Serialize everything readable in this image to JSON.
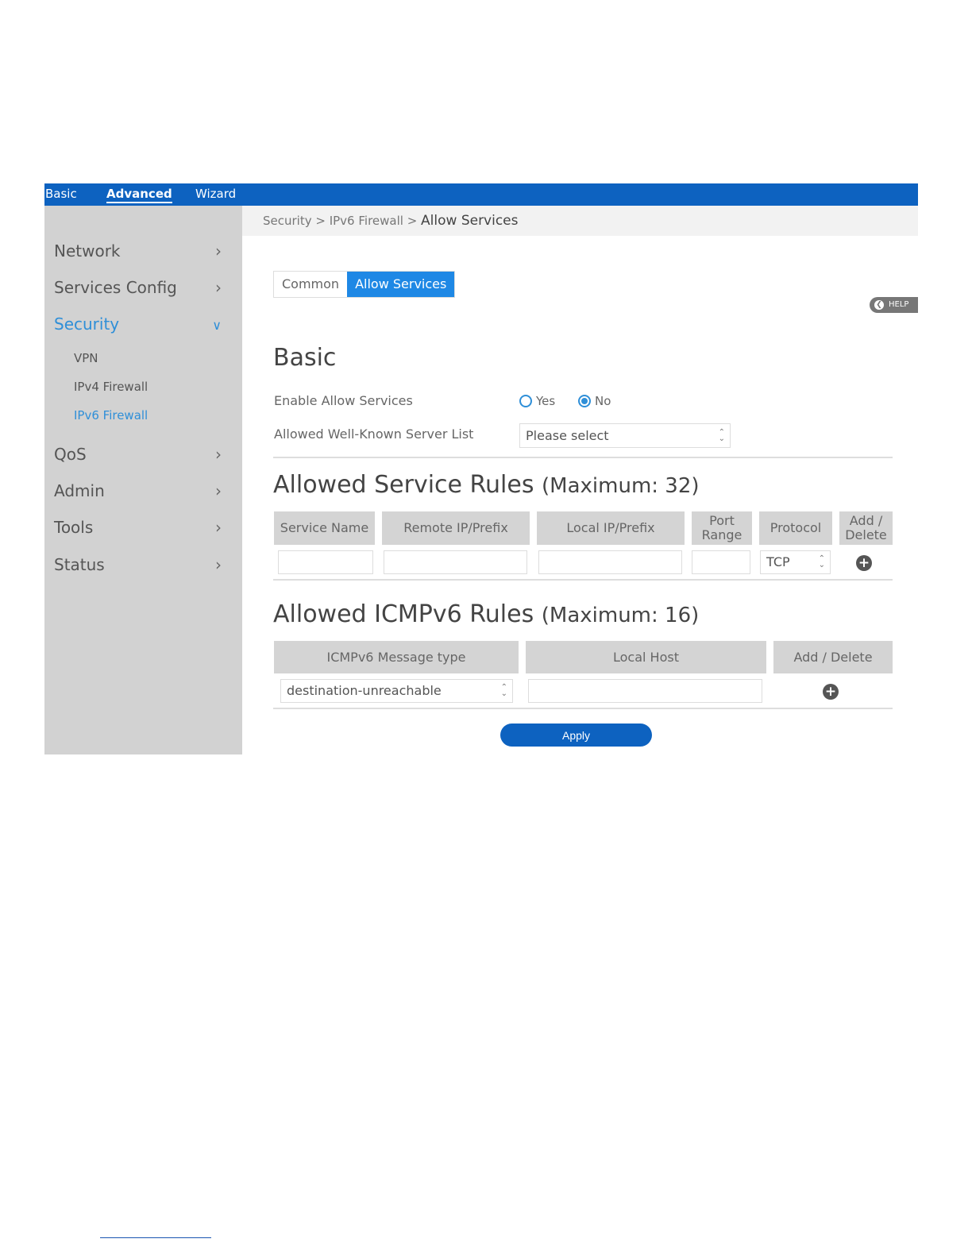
{
  "topnav": {
    "basic": "Basic",
    "advanced": "Advanced",
    "wizard": "Wizard"
  },
  "sidebar": {
    "items": [
      {
        "label": "Network"
      },
      {
        "label": "Services Config"
      },
      {
        "label": "Security"
      },
      {
        "label": "QoS"
      },
      {
        "label": "Admin"
      },
      {
        "label": "Tools"
      },
      {
        "label": "Status"
      }
    ],
    "security_sub": [
      {
        "label": "VPN"
      },
      {
        "label": "IPv4 Firewall"
      },
      {
        "label": "IPv6 Firewall"
      }
    ]
  },
  "breadcrumb": {
    "path": "Security > IPv6 Firewall > ",
    "current": "Allow Services"
  },
  "tabs": {
    "common": "Common",
    "allow": "Allow Services"
  },
  "help": {
    "label": "HELP"
  },
  "basic": {
    "heading": "Basic",
    "enable_label": "Enable Allow Services",
    "yes": "Yes",
    "no": "No",
    "selected": "No",
    "server_list_label": "Allowed Well-Known Server List",
    "server_list_value": "Please select"
  },
  "service_rules": {
    "heading": "Allowed Service Rules",
    "max": "(Maximum: 32)",
    "columns": [
      "Service Name",
      "Remote IP/Prefix",
      "Local IP/Prefix",
      "Port Range",
      "Protocol",
      "Add / Delete"
    ],
    "protocol_value": "TCP"
  },
  "icmp_rules": {
    "heading": "Allowed ICMPv6 Rules",
    "max": "(Maximum: 16)",
    "columns": [
      "ICMPv6 Message type",
      "Local Host",
      "Add / Delete"
    ],
    "message_type_value": "destination-unreachable"
  },
  "apply_label": "Apply",
  "colors": {
    "brand_blue": "#0d62c0",
    "accent_blue": "#1e88e5",
    "sidebar_gray": "#d2d2d2"
  },
  "icons": {
    "chevron": "chevron-right-icon",
    "add": "plus-circle-icon",
    "help": "back-arrow-icon"
  }
}
